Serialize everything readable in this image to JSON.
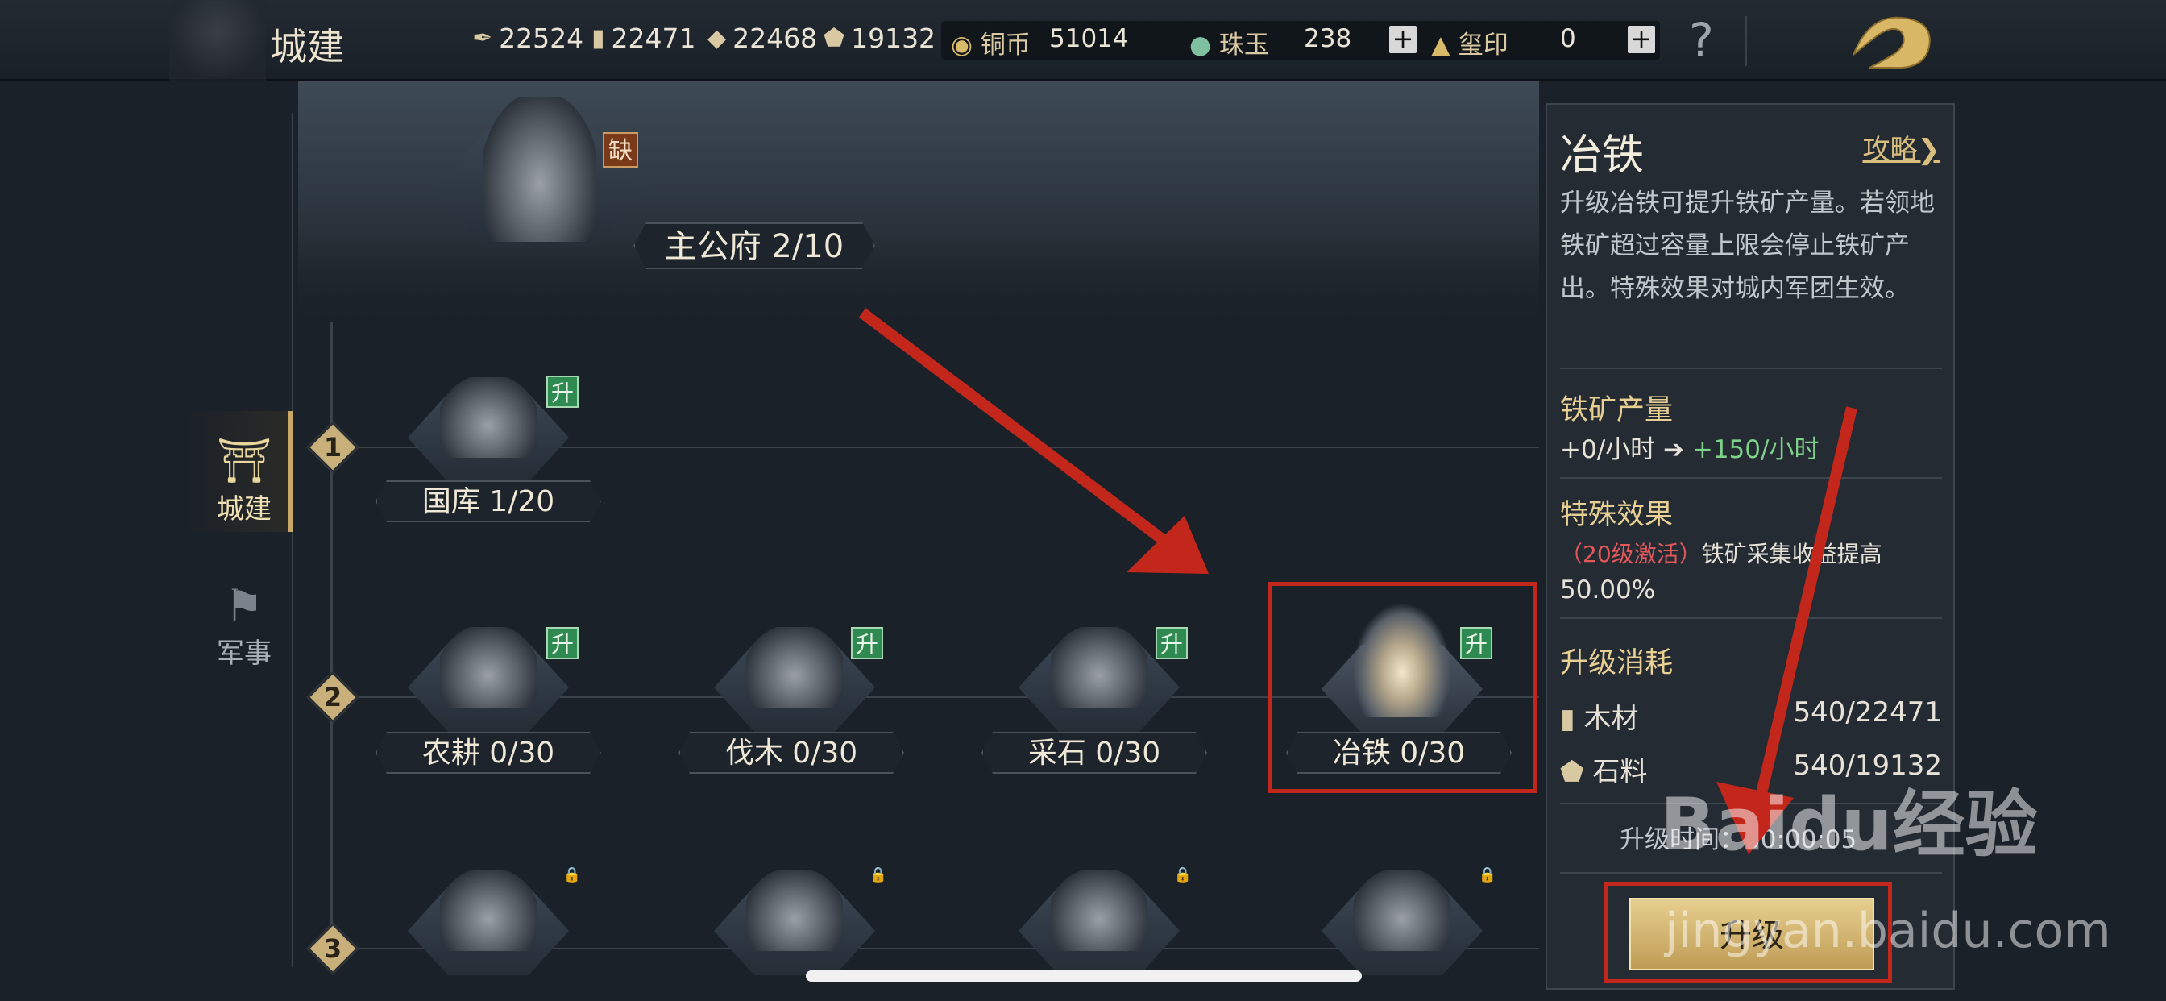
{
  "header": {
    "title": "城建",
    "resources": [
      {
        "icon": "feather-icon",
        "value": "22524"
      },
      {
        "icon": "wood-icon",
        "value": "22471"
      },
      {
        "icon": "ore-icon",
        "value": "22468"
      },
      {
        "icon": "stone-icon",
        "value": "19132"
      }
    ],
    "copper_label": "铜币",
    "copper_value": "51014",
    "jade_label": "珠玉",
    "jade_value": "238",
    "seal_label": "玺印",
    "seal_value": "0",
    "help": "?"
  },
  "nav": {
    "items": [
      {
        "label": "城建",
        "active": true
      },
      {
        "label": "军事",
        "active": false
      }
    ]
  },
  "main_building": {
    "label": "主公府 2/10",
    "badge": "缺"
  },
  "tiers": [
    {
      "num": "1",
      "buildings": [
        {
          "label": "国库 1/20",
          "badge": "升"
        }
      ]
    },
    {
      "num": "2",
      "buildings": [
        {
          "label": "农耕 0/30",
          "badge": "升"
        },
        {
          "label": "伐木 0/30",
          "badge": "升"
        },
        {
          "label": "采石 0/30",
          "badge": "升"
        },
        {
          "label": "冶铁 0/30",
          "badge": "升"
        }
      ]
    },
    {
      "num": "3",
      "buildings": [
        {
          "label": "",
          "badge": ""
        },
        {
          "label": "",
          "badge": ""
        },
        {
          "label": "",
          "badge": ""
        },
        {
          "label": "",
          "badge": ""
        }
      ]
    }
  ],
  "panel": {
    "title": "冶铁",
    "guide": "攻略",
    "desc": "升级冶铁可提升铁矿产量。若领地铁矿超过容量上限会停止铁矿产出。特殊效果对城内军团生效。",
    "output_heading": "铁矿产量",
    "output_from": "+0/小时",
    "output_to": "+150/小时",
    "special_heading": "特殊效果",
    "special_activation": "（20级激活）",
    "special_desc": "铁矿采集收益提高",
    "special_value": "50.00%",
    "cost_heading": "升级消耗",
    "costs": [
      {
        "name": "木材",
        "value": "540/22471"
      },
      {
        "name": "石料",
        "value": "540/19132"
      }
    ],
    "time_label": "升级时间：00:00:05",
    "upgrade_button": "升级"
  },
  "watermark": {
    "main": "Baidu经验",
    "sub": "jingyan.baidu.com"
  },
  "colors": {
    "accent": "#c9b07a",
    "highlight": "#c3271c",
    "upgrade_badge": "#2f8a52"
  }
}
